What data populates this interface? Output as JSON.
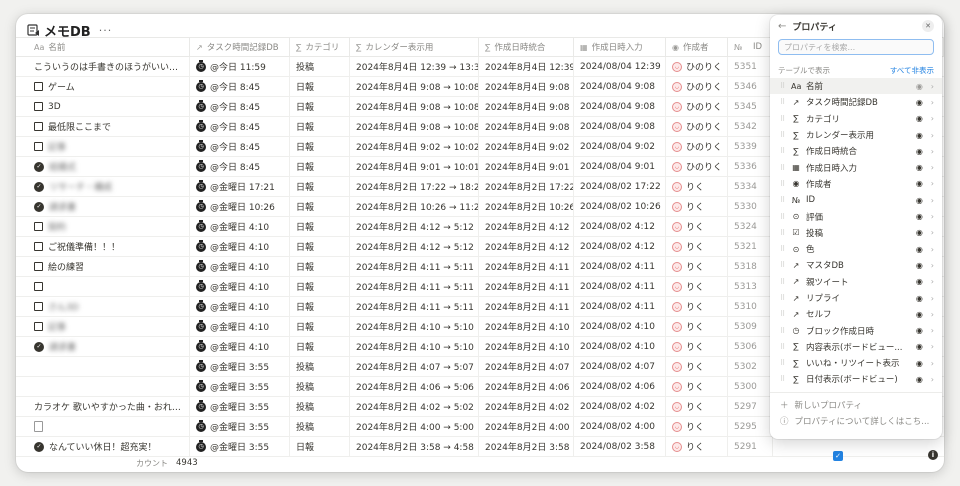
{
  "title": "メモDB",
  "more": "···",
  "headers": {
    "name": "名前",
    "time_db": "タスク時間記録DB",
    "category": "カテゴリ",
    "calendar": "カレンダー表示用",
    "created_combined": "作成日時統合",
    "created_input": "作成日時入力",
    "author": "作成者",
    "id": "ID"
  },
  "header_icons": {
    "name": "Aa",
    "time_db": "↗",
    "category": "∑",
    "calendar": "∑",
    "created_combined": "∑",
    "created_input": "▦",
    "author": "◉",
    "id": "№"
  },
  "rows": [
    {
      "name": "こういうのは手書きのほうがいいかも？",
      "mark": "none",
      "blur": false,
      "tt": "@今日 11:59",
      "cat": "投稿",
      "cal": "2024年8月4日 12:39 → 13:39",
      "made": "2024年8月4日 12:39",
      "mi": "2024/08/04 12:39",
      "by": "ひのりく",
      "id": "5351"
    },
    {
      "name": "ゲーム",
      "mark": "box",
      "blur": false,
      "tt": "@今日 8:45",
      "cat": "日報",
      "cal": "2024年8月4日 9:08 → 10:08",
      "made": "2024年8月4日 9:08",
      "mi": "2024/08/04 9:08",
      "by": "ひのりく",
      "id": "5346"
    },
    {
      "name": "3D",
      "mark": "box",
      "blur": false,
      "tt": "@今日 8:45",
      "cat": "日報",
      "cal": "2024年8月4日 9:08 → 10:08",
      "made": "2024年8月4日 9:08",
      "mi": "2024/08/04 9:08",
      "by": "ひのりく",
      "id": "5345"
    },
    {
      "name": "最低限ここまで",
      "mark": "box",
      "blur": false,
      "tt": "@今日 8:45",
      "cat": "日報",
      "cal": "2024年8月4日 9:08 → 10:08",
      "made": "2024年8月4日 9:08",
      "mi": "2024/08/04 9:08",
      "by": "ひのりく",
      "id": "5342"
    },
    {
      "name": "記事",
      "mark": "box",
      "blur": true,
      "tt": "@今日 8:45",
      "cat": "日報",
      "cal": "2024年8月4日 9:02 → 10:02",
      "made": "2024年8月4日 9:02",
      "mi": "2024/08/04 9:02",
      "by": "ひのりく",
      "id": "5339"
    },
    {
      "name": "結婚式",
      "mark": "check",
      "blur": true,
      "tt": "@今日 8:45",
      "cat": "日報",
      "cal": "2024年8月4日 9:01 → 10:01",
      "made": "2024年8月4日 9:01",
      "mi": "2024/08/04 9:01",
      "by": "ひのりく",
      "id": "5336"
    },
    {
      "name": "リサーチ・構成",
      "mark": "check",
      "blur": true,
      "tt": "@金曜日 17:21",
      "cat": "日報",
      "cal": "2024年8月2日 17:22 → 18:22",
      "made": "2024年8月2日 17:22",
      "mi": "2024/08/02 17:22",
      "by": "りく",
      "id": "5334"
    },
    {
      "name": "請求書",
      "mark": "check",
      "blur": true,
      "tt": "@金曜日 10:26",
      "cat": "日報",
      "cal": "2024年8月2日 10:26 → 11:26",
      "made": "2024年8月2日 10:26",
      "mi": "2024/08/02 10:26",
      "by": "りく",
      "id": "5330"
    },
    {
      "name": "契約",
      "mark": "box",
      "blur": true,
      "tt": "@金曜日 4:10",
      "cat": "日報",
      "cal": "2024年8月2日 4:12 → 5:12",
      "made": "2024年8月2日 4:12",
      "mi": "2024/08/02 4:12",
      "by": "りく",
      "id": "5324"
    },
    {
      "name": "ご祝儀準備！！！",
      "mark": "box",
      "blur": false,
      "tt": "@金曜日 4:10",
      "cat": "日報",
      "cal": "2024年8月2日 4:12 → 5:12",
      "made": "2024年8月2日 4:12",
      "mi": "2024/08/02 4:12",
      "by": "りく",
      "id": "5321"
    },
    {
      "name": "絵の練習",
      "mark": "box",
      "blur": false,
      "tt": "@金曜日 4:10",
      "cat": "日報",
      "cal": "2024年8月2日 4:11 → 5:11",
      "made": "2024年8月2日 4:11",
      "mi": "2024/08/02 4:11",
      "by": "りく",
      "id": "5318"
    },
    {
      "name": "",
      "mark": "box",
      "blur": true,
      "tt": "@金曜日 4:10",
      "cat": "日報",
      "cal": "2024年8月2日 4:11 → 5:11",
      "made": "2024年8月2日 4:11",
      "mi": "2024/08/02 4:11",
      "by": "りく",
      "id": "5313"
    },
    {
      "name": "さん3D",
      "mark": "box",
      "blur": true,
      "tt": "@金曜日 4:10",
      "cat": "日報",
      "cal": "2024年8月2日 4:11 → 5:11",
      "made": "2024年8月2日 4:11",
      "mi": "2024/08/02 4:11",
      "by": "りく",
      "id": "5310"
    },
    {
      "name": "記事",
      "mark": "box",
      "blur": true,
      "tt": "@金曜日 4:10",
      "cat": "日報",
      "cal": "2024年8月2日 4:10 → 5:10",
      "made": "2024年8月2日 4:10",
      "mi": "2024/08/02 4:10",
      "by": "りく",
      "id": "5309"
    },
    {
      "name": "請求書",
      "mark": "check",
      "blur": true,
      "tt": "@金曜日 4:10",
      "cat": "日報",
      "cal": "2024年8月2日 4:10 → 5:10",
      "made": "2024年8月2日 4:10",
      "mi": "2024/08/02 4:10",
      "by": "りく",
      "id": "5306"
    },
    {
      "name": "",
      "mark": "none",
      "blur": true,
      "tt": "@金曜日 3:55",
      "cat": "投稿",
      "cal": "2024年8月2日 4:07 → 5:07",
      "made": "2024年8月2日 4:07",
      "mi": "2024/08/02 4:07",
      "by": "りく",
      "id": "5302"
    },
    {
      "name": "",
      "mark": "none",
      "blur": true,
      "tt": "@金曜日 3:55",
      "cat": "投稿",
      "cal": "2024年8月2日 4:06 → 5:06",
      "made": "2024年8月2日 4:06",
      "mi": "2024/08/02 4:06",
      "by": "りく",
      "id": "5300"
    },
    {
      "name": "カラオケ 歌いやすかった曲・おれらリサイ",
      "mark": "none",
      "blur": false,
      "tt": "@金曜日 3:55",
      "cat": "投稿",
      "cal": "2024年8月2日 4:02 → 5:02",
      "made": "2024年8月2日 4:02",
      "mi": "2024/08/02 4:02",
      "by": "りく",
      "id": "5297"
    },
    {
      "name": "",
      "mark": "doc",
      "blur": true,
      "tt": "@金曜日 3:55",
      "cat": "投稿",
      "cal": "2024年8月2日 4:00 → 5:00",
      "made": "2024年8月2日 4:00",
      "mi": "2024/08/02 4:00",
      "by": "りく",
      "id": "5295"
    },
    {
      "name": "なんていい休日！超充実！",
      "mark": "check",
      "blur": false,
      "tt": "@金曜日 3:55",
      "cat": "日報",
      "cal": "2024年8月2日 3:58 → 4:58",
      "made": "2024年8月2日 3:58",
      "mi": "2024/08/02 3:58",
      "by": "りく",
      "id": "5291"
    }
  ],
  "footer": {
    "label": "カウント",
    "count": "4943"
  },
  "panel": {
    "title": "プロパティ",
    "search_placeholder": "プロパティを検索...",
    "section_label": "テーブルで表示",
    "hide_all": "すべて非表示",
    "properties": [
      {
        "icon": "Aa",
        "label": "名前",
        "eye": "dim",
        "icon_name": "text-icon"
      },
      {
        "icon": "↗",
        "label": "タスク時間記録DB",
        "eye": "on",
        "icon_name": "relation-icon"
      },
      {
        "icon": "∑",
        "label": "カテゴリ",
        "eye": "on",
        "icon_name": "formula-icon"
      },
      {
        "icon": "∑",
        "label": "カレンダー表示用",
        "eye": "on",
        "icon_name": "formula-icon"
      },
      {
        "icon": "∑",
        "label": "作成日時統合",
        "eye": "on",
        "icon_name": "formula-icon"
      },
      {
        "icon": "▦",
        "label": "作成日時入力",
        "eye": "on",
        "icon_name": "calendar-icon"
      },
      {
        "icon": "◉",
        "label": "作成者",
        "eye": "on",
        "icon_name": "person-icon"
      },
      {
        "icon": "№",
        "label": "ID",
        "eye": "on",
        "icon_name": "id-icon"
      },
      {
        "icon": "⊙",
        "label": "評価",
        "eye": "on",
        "icon_name": "select-icon"
      },
      {
        "icon": "☑",
        "label": "投稿",
        "eye": "on",
        "icon_name": "checkbox-icon"
      },
      {
        "icon": "⊙",
        "label": "色",
        "eye": "on",
        "icon_name": "select-icon"
      },
      {
        "icon": "↗",
        "label": "マスタDB",
        "eye": "on",
        "icon_name": "relation-icon"
      },
      {
        "icon": "↗",
        "label": "親ツイート",
        "eye": "on",
        "icon_name": "relation-icon"
      },
      {
        "icon": "↗",
        "label": "リプライ",
        "eye": "on",
        "icon_name": "relation-icon"
      },
      {
        "icon": "↗",
        "label": "セルフ",
        "eye": "on",
        "icon_name": "relation-icon"
      },
      {
        "icon": "◷",
        "label": "ブロック作成日時",
        "eye": "on",
        "icon_name": "clock-icon"
      },
      {
        "icon": "∑",
        "label": "内容表示(ボードビュー...",
        "eye": "on",
        "icon_name": "formula-icon"
      },
      {
        "icon": "∑",
        "label": "いいね・リツイート表示",
        "eye": "on",
        "icon_name": "formula-icon"
      },
      {
        "icon": "∑",
        "label": "日付表示(ボードビュー)",
        "eye": "on",
        "icon_name": "formula-icon"
      }
    ],
    "new_property": "新しいプロパティ",
    "learn_more": "プロパティについて詳しくはこち..."
  }
}
